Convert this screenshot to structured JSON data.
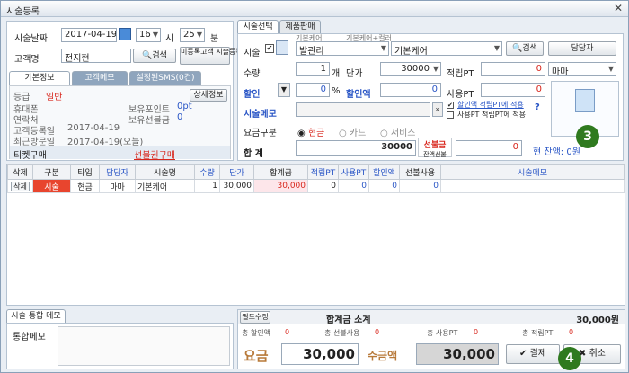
{
  "window": {
    "title": "시술등록",
    "close": "✕"
  },
  "left": {
    "date_label": "시술날짜",
    "date_value": "2017-04-19",
    "hour": "16",
    "hour_unit": "시",
    "minute": "25",
    "minute_unit": "분",
    "customer_label": "고객명",
    "customer_value": "전지현",
    "search_btn": "검색",
    "unregistered_btn": "미등록고객 시술등록",
    "tabs": [
      "기본정보",
      "고객메모",
      "설정된SMS(0건)"
    ],
    "info": {
      "grade_label": "등급",
      "grade_value": "일반",
      "detail_btn": "상세정보",
      "phone_label": "휴대폰",
      "point_label": "보유포인트",
      "point_value": "0pt",
      "contact_label": "연락처",
      "prepay_label": "보유선불금",
      "prepay_value": "0",
      "reg_label": "고객등록일",
      "reg_value": "2017-04-19",
      "visit_label": "최근방문일",
      "visit_value": "2017-04-19(오늘)",
      "ticket_label": "티켓구매",
      "voucher_label": "선불권구매"
    }
  },
  "right": {
    "tabs": [
      "시술선택",
      "제품판매"
    ],
    "service_label": "시술",
    "category_hint": "기본케어",
    "sub_hint": "기본케어+컬러",
    "category_value": "발관리",
    "sub_value": "기본케어",
    "search_btn": "검색",
    "staff_btn": "담당자",
    "qty_label": "수량",
    "qty_value": "1",
    "qty_unit": "개",
    "price_label": "단가",
    "price_value": "30000",
    "earn_label": "적립PT",
    "earn_value": "0",
    "staff_value": "마마",
    "discount_label": "할인",
    "discount_value": "0",
    "discount_unit": "%",
    "discount_amt_label": "할인액",
    "discount_amt_value": "0",
    "use_pt_label": "사용PT",
    "use_pt_value": "0",
    "memo_label": "시술메모",
    "chk1": "할인액 적립PT에 적용",
    "chk2": "사용PT 적립PT에 적용",
    "pay_label": "요금구분",
    "pay_options": [
      "현금",
      "카드",
      "서비스"
    ],
    "total_label": "합 계",
    "total_value": "30000",
    "prepaid_label": "선불금",
    "prepaid_sub": "잔액선불",
    "prepaid_value": "0",
    "balance_label": "현 잔액: 0원"
  },
  "grid": {
    "headers": [
      "삭제",
      "구분",
      "타입",
      "담당자",
      "시술명",
      "수량",
      "단가",
      "합계금",
      "적립PT",
      "사용PT",
      "할인액",
      "선불사용",
      "시술메모"
    ],
    "rows": [
      [
        "삭제",
        "시술",
        "현금",
        "마마",
        "기본케어",
        "1",
        "30,000",
        "30,000",
        "0",
        "0",
        "0",
        "0",
        ""
      ]
    ]
  },
  "bottom": {
    "memo_tab": "시술 통합 메모",
    "memo_label": "통합메모",
    "edit_btn": "필드수정",
    "subtotal_label": "합계금 소계",
    "subtotal_value": "30,000원",
    "sum_discount": "총 할인액",
    "sum_discount_v": "0",
    "sum_prepay": "총 선불사용",
    "sum_prepay_v": "0",
    "sum_pt": "총 사용PT",
    "sum_pt_v": "0",
    "sum_earn": "총 적립PT",
    "sum_earn_v": "0",
    "fee_label": "요금",
    "fee_value": "30,000",
    "received_label": "수금액",
    "received_value": "30,000",
    "pay_btn": "결제",
    "cancel_btn": "취소"
  },
  "callouts": [
    "3",
    "4"
  ]
}
